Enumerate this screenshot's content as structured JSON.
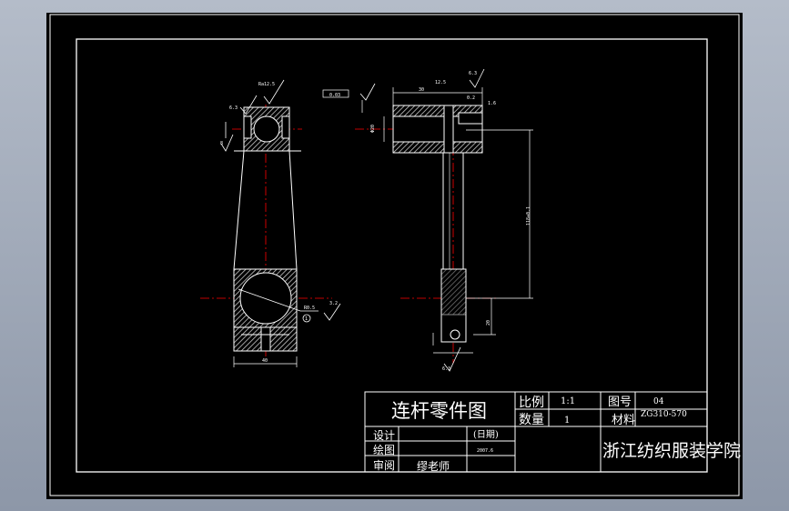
{
  "title_block": {
    "part_name": "连杆零件图",
    "scale_label": "比例",
    "scale_value": "1:1",
    "quantity_label": "数量",
    "quantity_value": "1",
    "drawing_no_label": "图号",
    "drawing_no_value": "04",
    "material_label": "材料",
    "material_value": "ZG310-570",
    "design_label": "设计",
    "drawn_label": "绘图",
    "review_label": "审阅",
    "date_label": "(日期)",
    "date_value": "2007.6",
    "reviewer": "缪老师",
    "institution": "浙江纺织服装学院"
  },
  "annotations": {
    "front_top_finish": "Ra12.5",
    "front_left_finish": "6.3",
    "front_left_tol": "8",
    "front_right_finish": "3.2",
    "front_right_leader": "R0.5",
    "front_detail_num": "1",
    "side_geom_tol": "0.03",
    "side_top_dim": "30",
    "side_top_finish": "6.3",
    "side_top_mid": "12.5",
    "side_top_right": "0.2",
    "side_right_small": "1.6",
    "side_left_vert": "Φ20",
    "side_long_dim": "118±0.1",
    "side_bottom_dim": "20",
    "side_bottom_finish": "6.3",
    "front_bottom_dim": "40"
  },
  "colors": {
    "background": "#000000",
    "border": "#ffffff",
    "centerline": "#ff0000",
    "hatch": "#c8c8c8"
  }
}
